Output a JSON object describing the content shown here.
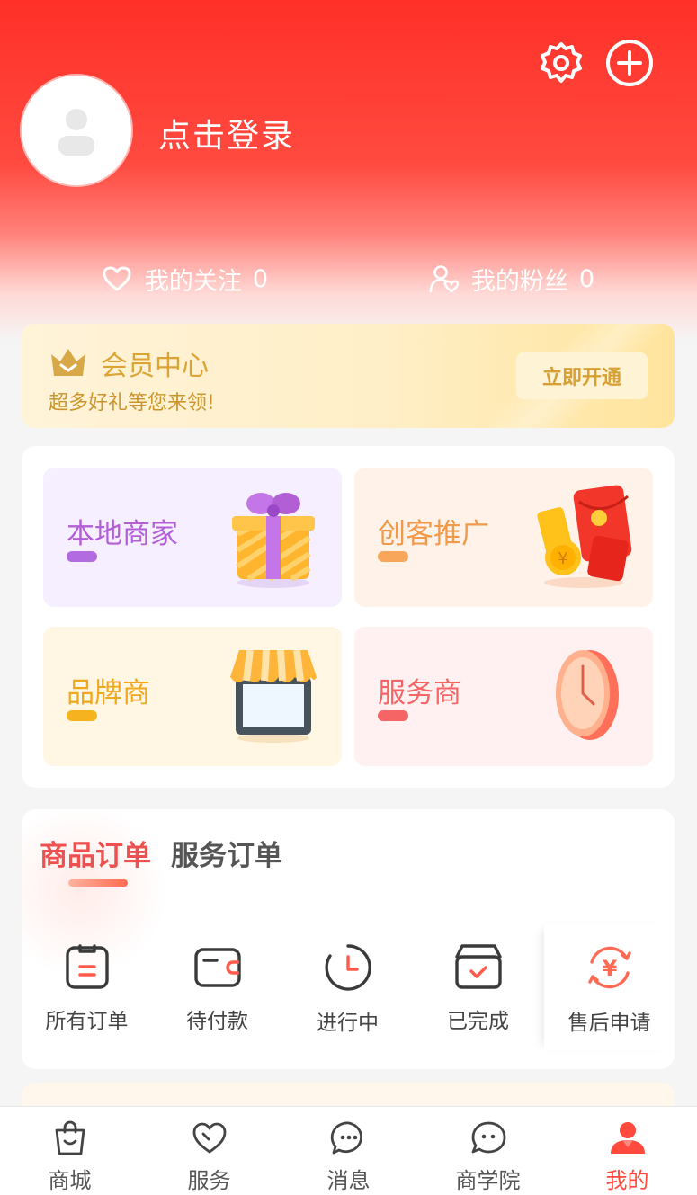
{
  "header": {
    "login_text": "点击登录",
    "settings_icon": "gear-icon",
    "add_icon": "plus-circle-icon"
  },
  "follow": {
    "following_label": "我的关注",
    "following_count": "0",
    "fans_label": "我的粉丝",
    "fans_count": "0"
  },
  "vip": {
    "title": "会员中心",
    "subtitle": "超多好礼等您来领!",
    "button": "立即开通",
    "icon": "crown-icon"
  },
  "tiles": [
    {
      "label": "本地商家",
      "color": "#b25fd6",
      "bg": "#f6efff",
      "icon": "gift-box-icon"
    },
    {
      "label": "创客推广",
      "color": "#f29a4a",
      "bg": "#fff2e8",
      "icon": "red-envelope-icon"
    },
    {
      "label": "品牌商",
      "color": "#f0a81c",
      "bg": "#fff6e4",
      "icon": "storefront-icon"
    },
    {
      "label": "服务商",
      "color": "#f56565",
      "bg": "#fff1f1",
      "icon": "clock-icon"
    }
  ],
  "orders": {
    "tabs": [
      "商品订单",
      "服务订单"
    ],
    "active_tab": "商品订单",
    "items": [
      {
        "label": "所有订单",
        "icon": "clipboard-icon"
      },
      {
        "label": "待付款",
        "icon": "wallet-icon"
      },
      {
        "label": "进行中",
        "icon": "clock-icon"
      },
      {
        "label": "已完成",
        "icon": "box-check-icon"
      },
      {
        "label": "售后申请",
        "icon": "yen-refresh-icon"
      }
    ]
  },
  "nav": {
    "items": [
      {
        "label": "商城",
        "icon": "shopping-bag-icon"
      },
      {
        "label": "服务",
        "icon": "heart-icon"
      },
      {
        "label": "消息",
        "icon": "chat-bubble-icon"
      },
      {
        "label": "商学院",
        "icon": "smile-bubble-icon"
      },
      {
        "label": "我的",
        "icon": "user-icon"
      }
    ],
    "active": "我的"
  },
  "colors": {
    "brand_red": "#ff3028",
    "accent_orange": "#ff6a4f",
    "gold": "#dca435"
  }
}
